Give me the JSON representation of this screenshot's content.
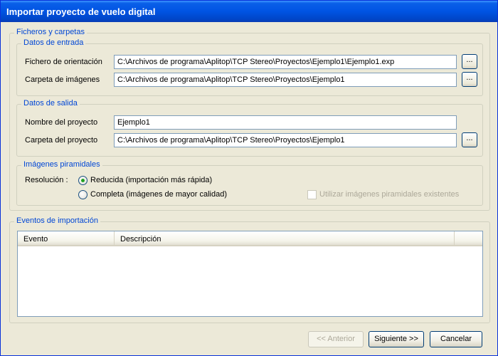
{
  "window": {
    "title": "Importar proyecto de vuelo digital"
  },
  "files_group": {
    "legend": "Ficheros y carpetas",
    "input_group": {
      "legend": "Datos de entrada",
      "orientation_label": "Fichero de orientación",
      "orientation_value": "C:\\Archivos de programa\\Aplitop\\TCP Stereo\\Proyectos\\Ejemplo1\\Ejemplo1.exp",
      "images_label": "Carpeta de imágenes",
      "images_value": "C:\\Archivos de programa\\Aplitop\\TCP Stereo\\Proyectos\\Ejemplo1",
      "browse_label": "..."
    },
    "output_group": {
      "legend": "Datos de salida",
      "project_name_label": "Nombre del proyecto",
      "project_name_value": "Ejemplo1",
      "project_folder_label": "Carpeta del proyecto",
      "project_folder_value": "C:\\Archivos de programa\\Aplitop\\TCP Stereo\\Proyectos\\Ejemplo1",
      "browse_label": "..."
    },
    "pyramid_group": {
      "legend": "Imágenes piramidales",
      "resolution_label": "Resolución :",
      "option_reduced": "Reducida (importación más rápida)",
      "option_complete": "Completa (imágenes de mayor calidad)",
      "selected": "reduced",
      "use_existing_label": "Utilizar imágenes  piramidales existentes",
      "use_existing_checked": false
    }
  },
  "events_group": {
    "legend": "Eventos de importación",
    "columns": [
      "Evento",
      "Descripción"
    ],
    "rows": []
  },
  "buttons": {
    "back": "<< Anterior",
    "next": "Siguiente >>",
    "cancel": "Cancelar"
  },
  "colors": {
    "title_bar": "#0054e3",
    "group_legend": "#0046d5",
    "window_bg": "#ece9d8",
    "radio_selected": "#21a121"
  }
}
